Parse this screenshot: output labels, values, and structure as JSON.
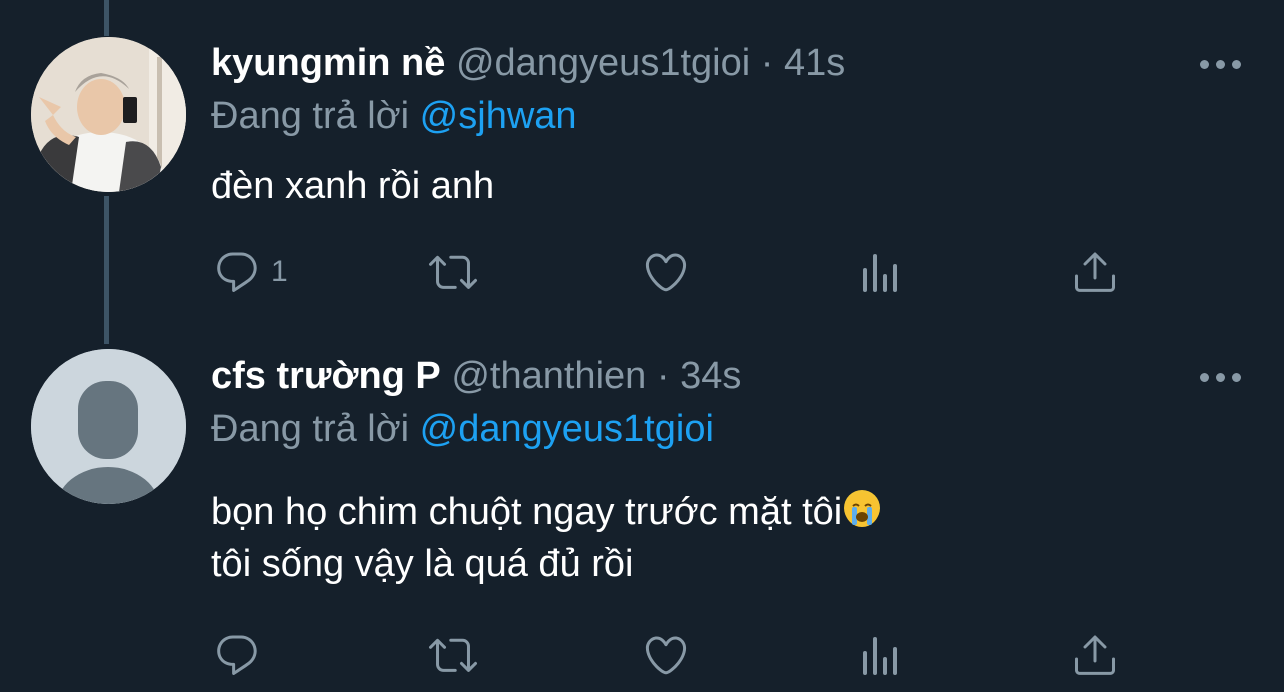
{
  "tweets": [
    {
      "name": "kyungmin nề",
      "handle": "@dangyeus1tgioi",
      "separator": "·",
      "time": "41s",
      "reply_prefix": "Đang trả lời",
      "reply_to": "@sjhwan",
      "text_lines": [
        "đèn xanh rồi anh"
      ],
      "avatar": "user-photo",
      "actions": {
        "reply_count": "1",
        "retweet_count": "",
        "like_count": ""
      }
    },
    {
      "name": "cfs trường P",
      "handle": "@thanthien",
      "separator": "·",
      "time": "34s",
      "reply_prefix": "Đang trả lời",
      "reply_to": "@dangyeus1tgioi",
      "text_lines": [
        "bọn họ chim chuột ngay trước mặt tôi",
        "tôi sống vậy là quá đủ rồi"
      ],
      "emoji": "loudly-crying-face",
      "avatar": "default-profile",
      "actions": {
        "reply_count": "",
        "retweet_count": "",
        "like_count": ""
      }
    }
  ],
  "colors": {
    "background": "#15202b",
    "text_primary": "#ffffff",
    "text_secondary": "#8899a6",
    "link": "#1da1f2",
    "thread_line": "#3d5466"
  },
  "icons": [
    "reply-icon",
    "retweet-icon",
    "like-icon",
    "analytics-icon",
    "share-icon",
    "more-icon"
  ]
}
